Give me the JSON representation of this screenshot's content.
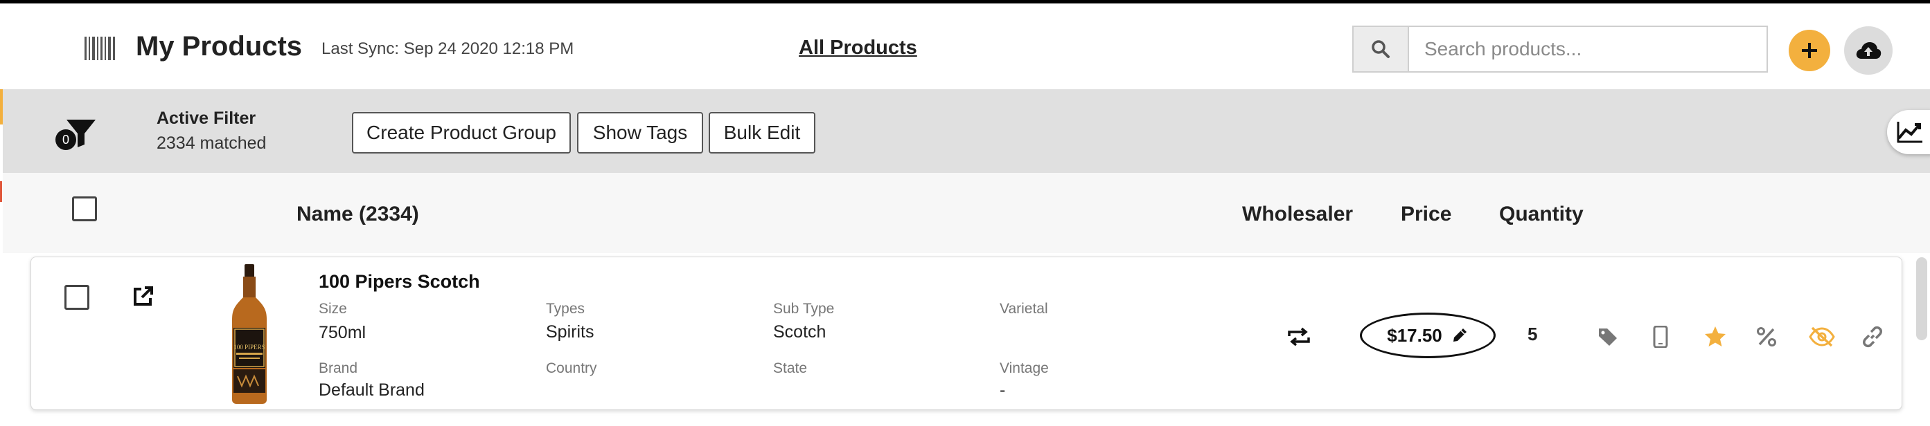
{
  "header": {
    "title": "My Products",
    "last_sync": "Last Sync: Sep 24 2020 12:18 PM",
    "view_link": "All Products",
    "search": {
      "placeholder": "Search products...",
      "value": ""
    }
  },
  "filter_bar": {
    "filter_count": "0",
    "active_filter_label": "Active Filter",
    "matched": "2334 matched",
    "buttons": {
      "create_group": "Create Product Group",
      "show_tags": "Show Tags",
      "bulk_edit": "Bulk Edit"
    }
  },
  "columns": {
    "name": "Name  (2334)",
    "wholesaler": "Wholesaler",
    "price": "Price",
    "quantity": "Quantity"
  },
  "products": [
    {
      "name": "100 Pipers Scotch",
      "bottle_label": "100 PIPERS",
      "fields": {
        "size": {
          "label": "Size",
          "value": "750ml"
        },
        "types": {
          "label": "Types",
          "value": "Spirits"
        },
        "sub_type": {
          "label": "Sub Type",
          "value": "Scotch"
        },
        "varietal": {
          "label": "Varietal",
          "value": ""
        },
        "brand": {
          "label": "Brand",
          "value": "Default Brand"
        },
        "country": {
          "label": "Country",
          "value": ""
        },
        "state": {
          "label": "State",
          "value": ""
        },
        "vintage": {
          "label": "Vintage",
          "value": "-"
        }
      },
      "price": "$17.50",
      "quantity": "5",
      "icons": [
        "tag-icon",
        "mobile-icon",
        "star-icon",
        "percent-icon",
        "eye-off-icon",
        "link-icon"
      ]
    }
  ],
  "colors": {
    "accent": "#f3b03e",
    "filter_bar_bg": "#e0e0e0",
    "header_row_bg": "#f7f7f7",
    "icon_gray": "#777777"
  }
}
